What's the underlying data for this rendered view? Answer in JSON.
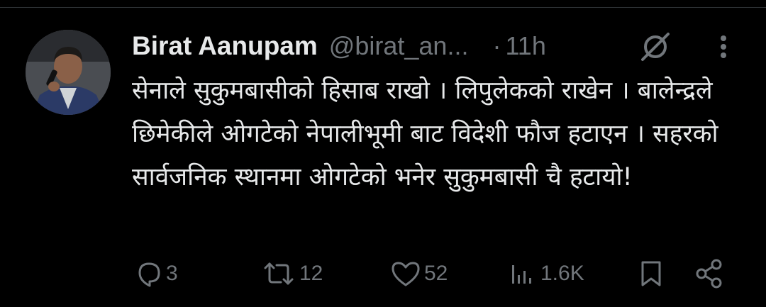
{
  "author": {
    "name": "Birat Aanupam",
    "handle": "@birat_an...",
    "separator": "·",
    "time": "11h"
  },
  "tweet": {
    "text": "सेनाले सुकुमबासीको हिसाब राखो । लिपुलेकको राखेन । बालेन्द्रले छिमेकीले ओगटेको नेपालीभूमी बाट विदेशी फौज हटाएन । सहरको सार्वजनिक स्थानमा ओगटेको भनेर सुकुमबासी चै हटायो!"
  },
  "actions": {
    "replies": "3",
    "reposts": "12",
    "likes": "52",
    "views": "1.6K"
  },
  "icons": [
    "grok-icon",
    "more-icon",
    "reply-icon",
    "repost-icon",
    "like-icon",
    "views-icon",
    "bookmark-icon",
    "share-icon"
  ],
  "colors": {
    "background": "#000000",
    "text": "#e7e9ea",
    "muted": "#71767b"
  }
}
